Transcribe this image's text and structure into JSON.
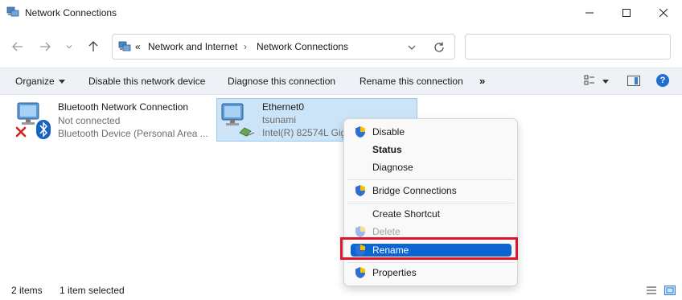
{
  "window": {
    "title": "Network Connections"
  },
  "nav": {
    "breadcrumb_prefix": "«",
    "breadcrumbs": [
      "Network and Internet",
      "Network Connections"
    ],
    "breadcrumb_sep": "›",
    "search_placeholder": ""
  },
  "toolbar": {
    "organize": "Organize",
    "disable": "Disable this network device",
    "diagnose": "Diagnose this connection",
    "rename": "Rename this connection",
    "more": "»"
  },
  "items": [
    {
      "name": "Bluetooth Network Connection",
      "status": "Not connected",
      "device": "Bluetooth Device (Personal Area ...",
      "selected": false
    },
    {
      "name": "Ethernet0",
      "status": "tsunami",
      "device": "Intel(R) 82574L Giga",
      "selected": true
    }
  ],
  "context_menu": {
    "items": [
      {
        "label": "Disable",
        "shield": true,
        "style": "normal"
      },
      {
        "label": "Status",
        "shield": false,
        "style": "bold"
      },
      {
        "label": "Diagnose",
        "shield": false,
        "style": "normal"
      },
      {
        "label": "Bridge Connections",
        "shield": true,
        "style": "normal"
      },
      {
        "label": "Create Shortcut",
        "shield": false,
        "style": "normal"
      },
      {
        "label": "Delete",
        "shield": true,
        "style": "disabled"
      },
      {
        "label": "Rename",
        "shield": true,
        "style": "highlighted"
      },
      {
        "label": "Properties",
        "shield": true,
        "style": "normal"
      }
    ]
  },
  "status": {
    "count": "2 items",
    "selected": "1 item selected"
  },
  "colors": {
    "accent": "#0a64d2",
    "selection_bg": "#cce4f7",
    "callout_red": "#e0142d",
    "toolbar_bg": "#eef2f7"
  }
}
